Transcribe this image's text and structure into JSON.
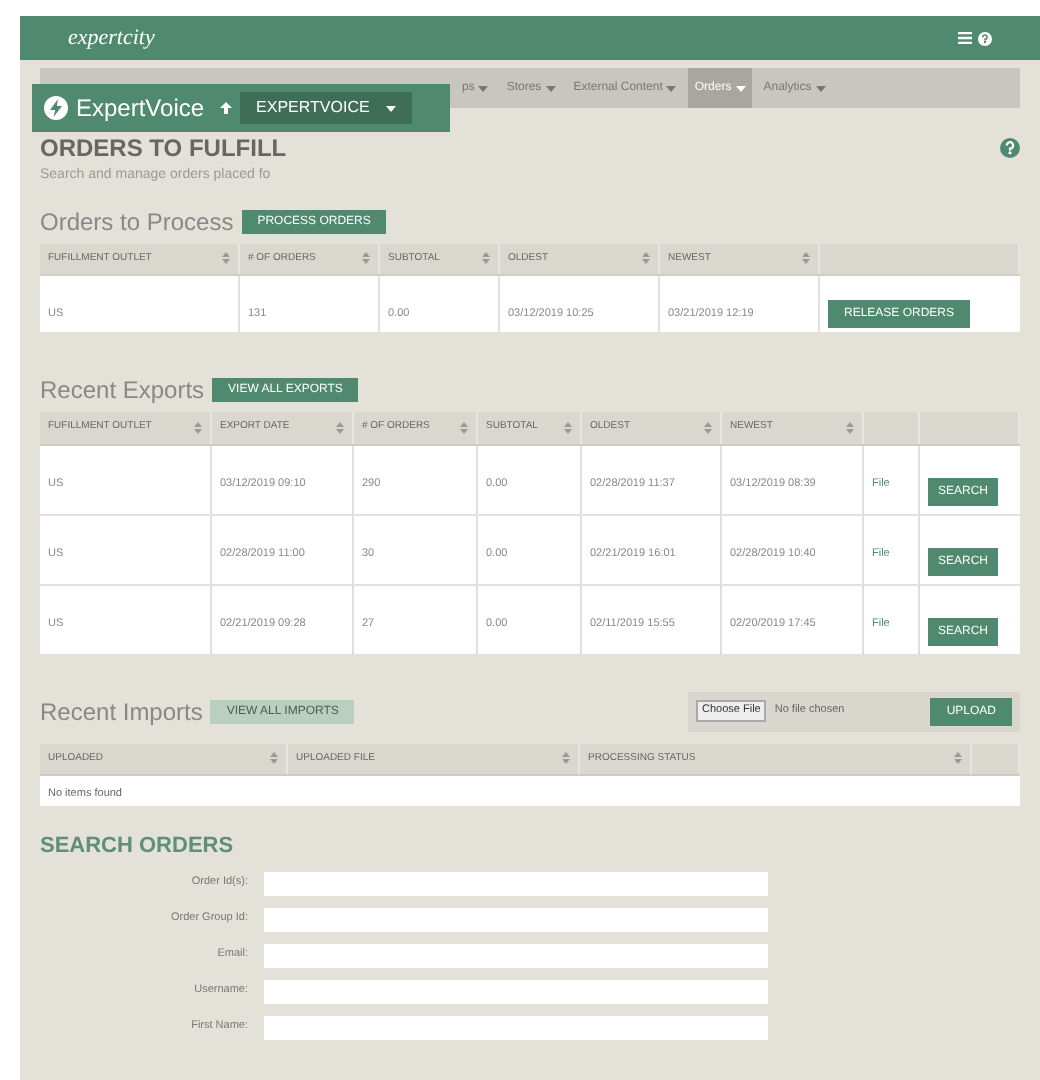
{
  "header": {
    "logo": "expertcity"
  },
  "overlay": {
    "brand": "ExpertVoice",
    "dropdown": "EXPERTVOICE"
  },
  "nav": [
    {
      "label": "ps",
      "selected": false
    },
    {
      "label": "Stores",
      "selected": false
    },
    {
      "label": "External Content",
      "selected": false
    },
    {
      "label": "Orders",
      "selected": true
    },
    {
      "label": "Analytics",
      "selected": false
    }
  ],
  "page": {
    "title": "ORDERS TO FULFILL",
    "subtitle": "Search and manage orders placed fo"
  },
  "orders_to_process": {
    "heading": "Orders to Process",
    "button": "PROCESS ORDERS",
    "columns": [
      "FUFILLMENT OUTLET",
      "# OF ORDERS",
      "SUBTOTAL",
      "OLDEST",
      "NEWEST"
    ],
    "rows": [
      {
        "cells": [
          "US",
          "131",
          "0.00",
          "03/12/2019 10:25",
          "03/21/2019 12:19"
        ],
        "action": "RELEASE ORDERS"
      }
    ]
  },
  "recent_exports": {
    "heading": "Recent Exports",
    "button": "VIEW ALL EXPORTS",
    "columns": [
      "FUFILLMENT OUTLET",
      "EXPORT DATE",
      "# OF ORDERS",
      "SUBTOTAL",
      "OLDEST",
      "NEWEST"
    ],
    "rows": [
      {
        "cells": [
          "US",
          "03/12/2019 09:10",
          "290",
          "0.00",
          "02/28/2019 11:37",
          "03/12/2019 08:39"
        ],
        "link": "File",
        "action": "SEARCH"
      },
      {
        "cells": [
          "US",
          "02/28/2019 11:00",
          "30",
          "0.00",
          "02/21/2019 16:01",
          "02/28/2019 10:40"
        ],
        "link": "File",
        "action": "SEARCH"
      },
      {
        "cells": [
          "US",
          "02/21/2019 09:28",
          "27",
          "0.00",
          "02/11/2019 15:55",
          "02/20/2019 17:45"
        ],
        "link": "File",
        "action": "SEARCH"
      }
    ]
  },
  "recent_imports": {
    "heading": "Recent Imports",
    "button": {
      "label": "VIEW ALL IMPORTS",
      "disabled": true
    },
    "file_input": {
      "button": "Choose File",
      "status": "No file chosen"
    },
    "upload": "UPLOAD",
    "columns": [
      "UPLOADED",
      "UPLOADED FILE",
      "PROCESSING STATUS"
    ],
    "empty": "No items found"
  },
  "search_orders": {
    "heading": "SEARCH ORDERS",
    "fields": [
      {
        "label": "Order Id(s):"
      },
      {
        "label": "Order Group Id:"
      },
      {
        "label": "Email:"
      },
      {
        "label": "Username:"
      },
      {
        "label": "First Name:"
      }
    ]
  }
}
